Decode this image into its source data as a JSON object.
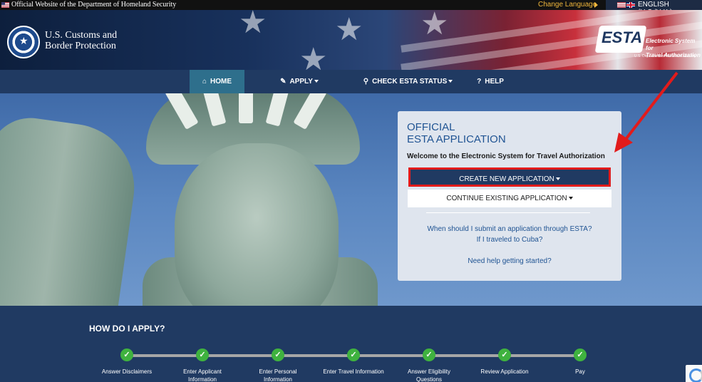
{
  "topbar": {
    "official_text": "Official Website of the Department of Homeland Security",
    "change_language": "Change Language",
    "language": "ENGLISH (U.S./U.K.)"
  },
  "header": {
    "agency_line1": "U.S. Customs and",
    "agency_line2": "Border Protection",
    "esta_logo_word": "ESTA",
    "esta_line1": "Electronic System for",
    "esta_line2": "Travel Authorization",
    "esta_dhs": "U.S. Department of Homeland Security"
  },
  "nav": {
    "items": [
      {
        "label": "HOME",
        "icon": "home-icon"
      },
      {
        "label": "APPLY",
        "icon": "pencil-icon"
      },
      {
        "label": "CHECK ESTA STATUS",
        "icon": "search-icon"
      },
      {
        "label": "HELP",
        "icon": "question-icon"
      }
    ]
  },
  "panel": {
    "title_line1": "OFFICIAL",
    "title_line2": "ESTA APPLICATION",
    "welcome": "Welcome to the Electronic System for Travel Authorization",
    "create_label": "CREATE NEW APPLICATION",
    "continue_label": "CONTINUE EXISTING APPLICATION",
    "link_when": "When should I submit an application through ESTA?",
    "link_cuba": "If I traveled to Cuba?",
    "link_help": "Need help getting started?"
  },
  "how": {
    "title": "HOW DO I APPLY?",
    "steps": [
      {
        "line1": "Answer Disclaimers",
        "line2": ""
      },
      {
        "line1": "Enter Applicant",
        "line2": "Information"
      },
      {
        "line1": "Enter Personal",
        "line2": "Information"
      },
      {
        "line1": "Enter Travel Information",
        "line2": ""
      },
      {
        "line1": "Answer Eligibility",
        "line2": "Questions"
      },
      {
        "line1": "Review Application",
        "line2": ""
      },
      {
        "line1": "Pay",
        "line2": ""
      }
    ]
  },
  "colors": {
    "nav": "#203a62",
    "active_tab": "#2e6f8c",
    "highlight": "#e21b1b",
    "link": "#205493",
    "check": "#3fb23f"
  }
}
